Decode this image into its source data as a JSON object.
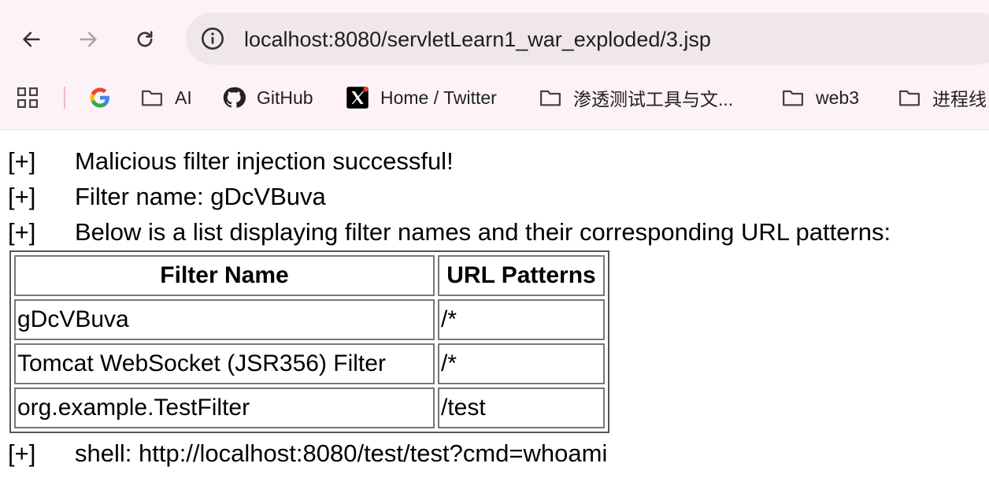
{
  "browser": {
    "url": "localhost:8080/servletLearn1_war_exploded/3.jsp",
    "bookmarks": [
      {
        "label": "",
        "icon": "google-icon"
      },
      {
        "label": "AI",
        "icon": "folder-icon"
      },
      {
        "label": "GitHub",
        "icon": "github-icon"
      },
      {
        "label": "Home / Twitter",
        "icon": "x-twitter-icon"
      },
      {
        "label": "渗透测试工具与文...",
        "icon": "folder-icon"
      },
      {
        "label": "web3",
        "icon": "folder-icon"
      },
      {
        "label": "进程线",
        "icon": "folder-icon"
      }
    ]
  },
  "page": {
    "tag": "[+]",
    "line1": "Malicious filter injection successful!",
    "line2": "Filter name: gDcVBuva",
    "line3": "Below is a list displaying filter names and their corresponding URL patterns:",
    "line4": "shell: http://localhost:8080/test/test?cmd=whoami",
    "table": {
      "headers": [
        "Filter Name",
        "URL Patterns"
      ],
      "rows": [
        [
          "gDcVBuva",
          "/*"
        ],
        [
          "Tomcat WebSocket (JSR356) Filter",
          "/*"
        ],
        [
          "org.example.TestFilter",
          "/test"
        ]
      ]
    }
  },
  "colors": {
    "chrome_bg": "#fdf2f7",
    "omnibox_bg": "#efe7ec",
    "divider": "#f2b6cf"
  }
}
